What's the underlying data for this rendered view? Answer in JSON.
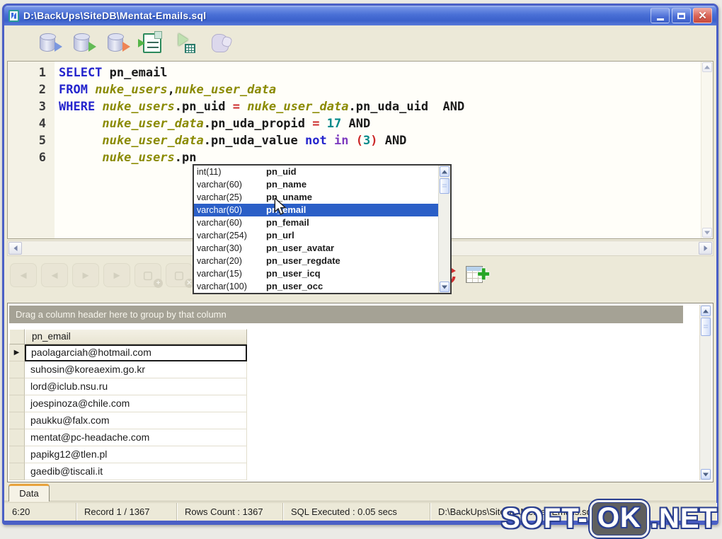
{
  "window": {
    "title": "D:\\BackUps\\SiteDB\\Mentat-Emails.sql"
  },
  "toolbar": {
    "icons": [
      "connect-database",
      "execute-query",
      "execute-update",
      "run-script",
      "explain-plan",
      "edit-mode"
    ]
  },
  "editor": {
    "lines": [
      {
        "no": "1",
        "segments": [
          {
            "c": "kw",
            "t": "SELECT"
          },
          {
            "c": "id",
            "t": " pn_email"
          }
        ]
      },
      {
        "no": "2",
        "segments": [
          {
            "c": "kw",
            "t": "FROM"
          },
          {
            "c": "id",
            "t": " "
          },
          {
            "c": "tbl",
            "t": "nuke_users"
          },
          {
            "c": "id",
            "t": ","
          },
          {
            "c": "tbl",
            "t": "nuke_user_data"
          }
        ]
      },
      {
        "no": "3",
        "segments": [
          {
            "c": "kw",
            "t": "WHERE"
          },
          {
            "c": "id",
            "t": " "
          },
          {
            "c": "tbl",
            "t": "nuke_users"
          },
          {
            "c": "id",
            "t": ".pn_uid "
          },
          {
            "c": "op",
            "t": "="
          },
          {
            "c": "id",
            "t": " "
          },
          {
            "c": "tbl",
            "t": "nuke_user_data"
          },
          {
            "c": "id",
            "t": ".pn_uda_uid  AND"
          }
        ]
      },
      {
        "no": "4",
        "segments": [
          {
            "c": "id",
            "t": "      "
          },
          {
            "c": "tbl",
            "t": "nuke_user_data"
          },
          {
            "c": "id",
            "t": ".pn_uda_propid "
          },
          {
            "c": "op",
            "t": "="
          },
          {
            "c": "id",
            "t": " "
          },
          {
            "c": "num",
            "t": "17"
          },
          {
            "c": "id",
            "t": " AND"
          }
        ]
      },
      {
        "no": "5",
        "segments": [
          {
            "c": "id",
            "t": "      "
          },
          {
            "c": "tbl",
            "t": "nuke_user_data"
          },
          {
            "c": "id",
            "t": ".pn_uda_value "
          },
          {
            "c": "kw",
            "t": "not"
          },
          {
            "c": "id",
            "t": " "
          },
          {
            "c": "kw2",
            "t": "in"
          },
          {
            "c": "id",
            "t": " "
          },
          {
            "c": "op",
            "t": "("
          },
          {
            "c": "num",
            "t": "3"
          },
          {
            "c": "op",
            "t": ")"
          },
          {
            "c": "id",
            "t": " AND"
          }
        ]
      },
      {
        "no": "6",
        "segments": [
          {
            "c": "id",
            "t": "      "
          },
          {
            "c": "tbl",
            "t": "nuke_users"
          },
          {
            "c": "id",
            "t": ".pn"
          }
        ]
      }
    ]
  },
  "autocomplete": {
    "items": [
      {
        "type": "int(11)",
        "name": "pn_uid"
      },
      {
        "type": "varchar(60)",
        "name": "pn_name"
      },
      {
        "type": "varchar(25)",
        "name": "pn_uname"
      },
      {
        "type": "varchar(60)",
        "name": "pn_email",
        "selected": true
      },
      {
        "type": "varchar(60)",
        "name": "pn_femail"
      },
      {
        "type": "varchar(254)",
        "name": "pn_url"
      },
      {
        "type": "varchar(30)",
        "name": "pn_user_avatar"
      },
      {
        "type": "varchar(20)",
        "name": "pn_user_regdate"
      },
      {
        "type": "varchar(15)",
        "name": "pn_user_icq"
      },
      {
        "type": "varchar(100)",
        "name": "pn_user_occ"
      }
    ]
  },
  "nav_toolbar": {
    "buttons": [
      {
        "name": "first-record",
        "glyph": "◄",
        "badge": ""
      },
      {
        "name": "prior-record",
        "glyph": "◄",
        "badge": ""
      },
      {
        "name": "next-record",
        "glyph": "►",
        "badge": ""
      },
      {
        "name": "last-record",
        "glyph": "►",
        "badge": ""
      },
      {
        "name": "insert-record",
        "glyph": "▢",
        "badge": "+"
      },
      {
        "name": "delete-record",
        "glyph": "▢",
        "badge": "✕"
      }
    ]
  },
  "grid": {
    "group_hint": "Drag a column header here to group by that column",
    "column_header": "pn_email",
    "row_marker": "▶",
    "selected_index": 0,
    "rows": [
      "paolagarciah@hotmail.com",
      "suhosin@koreaexim.go.kr",
      "lord@iclub.nsu.ru",
      "joespinoza@chile.com",
      "paukku@falx.com",
      "mentat@pc-headache.com",
      "papikg12@tlen.pl",
      "gaedib@tiscali.it"
    ]
  },
  "tabs": {
    "data_label": "Data"
  },
  "status": {
    "time": "6:20",
    "record": "Record  1 / 1367",
    "rows_count": "Rows Count  : 1367",
    "sql_executed": "SQL Executed : 0.05 secs",
    "file_path": "D:\\BackUps\\SiteDB\\Mentat-Emails.sql"
  },
  "watermark": {
    "part1": "SOFT-",
    "part2": "OK",
    "part3": ".NET"
  },
  "colors": {
    "titlebar_blue": "#4a70d6",
    "window_border": "#4a5fc6",
    "client_beige": "#ece9d8",
    "selection_blue": "#2b5fc7",
    "syntax_keyword": "#2424cd",
    "syntax_keyword2": "#7e3bbf",
    "syntax_table": "#8a8a00",
    "syntax_operator": "#cc2a2a",
    "syntax_number": "#008a8a",
    "group_bar_gray": "#a5a295"
  }
}
